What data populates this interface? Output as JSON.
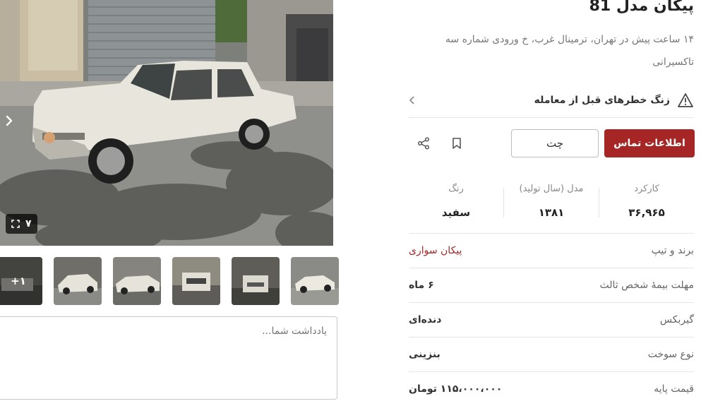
{
  "listing": {
    "title": "پیکان مدل 81",
    "location": "۱۴ ساعت پیش در تهران، ترمینال غرب، خ ورودی شماره سه تاکسیرانی"
  },
  "gallery": {
    "photo_count": "۷",
    "more_count": "+۱",
    "next_icon": "chevron-right-icon",
    "expand_icon": "expand-icon"
  },
  "note": {
    "placeholder": "یادداشت شما..."
  },
  "risk": {
    "label": "زنگ خطرهای قبل از معامله"
  },
  "actions": {
    "contact_label": "اطلاعات تماس",
    "chat_label": "چت"
  },
  "stats": [
    {
      "label": "کارکرد",
      "value": "۳۶,۹۶۵"
    },
    {
      "label": "مدل (سال تولید)",
      "value": "۱۳۸۱"
    },
    {
      "label": "رنگ",
      "value": "سفید"
    }
  ],
  "details": [
    {
      "label": "برند و تیپ",
      "value": "پیکان سواری"
    },
    {
      "label": "مهلت بیمهٔ شخص ثالث",
      "value": "۶ ماه"
    },
    {
      "label": "گیربکس",
      "value": "دنده‌ای"
    },
    {
      "label": "نوع سوخت",
      "value": "بنزینی"
    },
    {
      "label": "قیمت پایه",
      "value": "۱۱۵،۰۰۰،۰۰۰ تومان"
    }
  ],
  "colors": {
    "accent": "#a62626",
    "car_body": "#e8e6dc",
    "shadow_ground": "#5f605c"
  }
}
